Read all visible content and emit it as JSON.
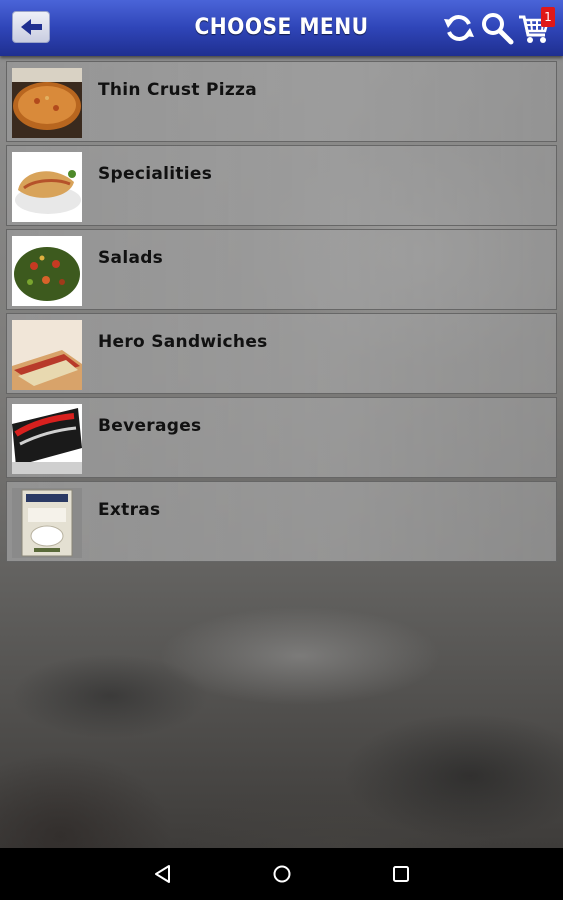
{
  "header": {
    "title": "CHOOSE MENU",
    "back_icon": "arrow-left-icon",
    "refresh_icon": "refresh-icon",
    "search_icon": "search-icon",
    "cart_icon": "cart-icon",
    "cart_count": "1",
    "colors": {
      "bar": "#2f45b8",
      "badge": "#e01818"
    }
  },
  "menu": {
    "items": [
      {
        "label": "Thin Crust Pizza",
        "thumbnail": "pizza-thumbnail"
      },
      {
        "label": "Specialities",
        "thumbnail": "calzone-thumbnail"
      },
      {
        "label": "Salads",
        "thumbnail": "salad-thumbnail"
      },
      {
        "label": "Hero Sandwiches",
        "thumbnail": "sandwich-thumbnail"
      },
      {
        "label": "Beverages",
        "thumbnail": "soda-can-thumbnail"
      },
      {
        "label": "Extras",
        "thumbnail": "dressing-packet-thumbnail"
      }
    ]
  },
  "navbar": {
    "back_icon": "nav-back-icon",
    "home_icon": "nav-home-icon",
    "recents_icon": "nav-recents-icon"
  }
}
